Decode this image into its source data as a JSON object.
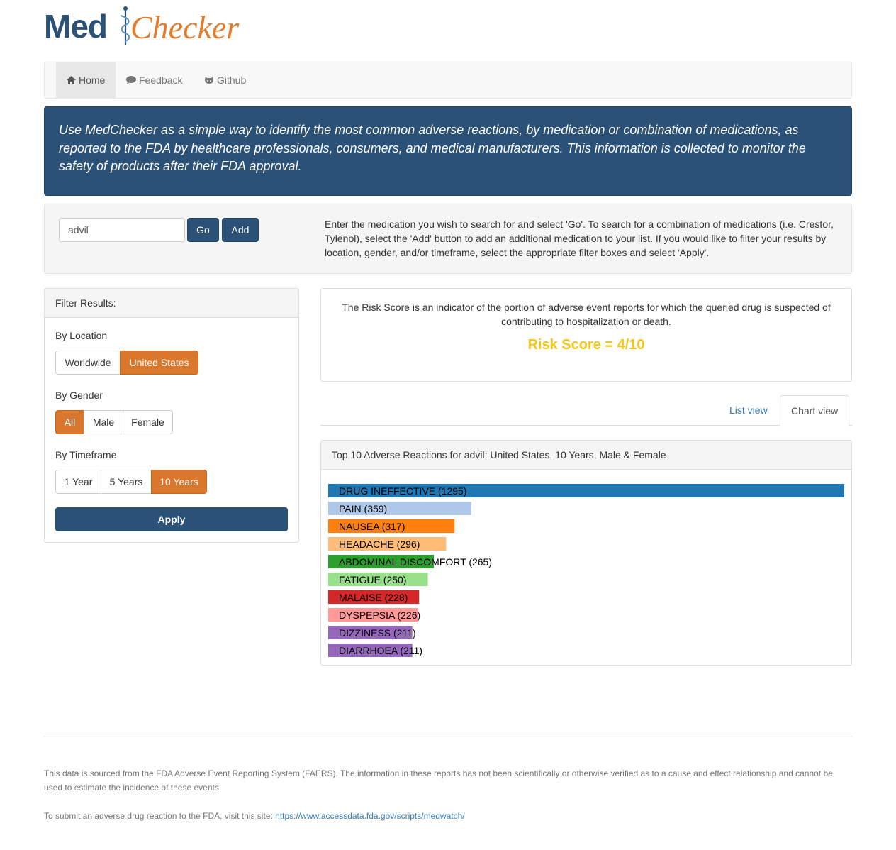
{
  "logo": {
    "part1": "Med",
    "part2": "Checker"
  },
  "nav": {
    "home": "Home",
    "feedback": "Feedback",
    "github": "Github"
  },
  "intro": "Use MedChecker as a simple way to identify the most common adverse reactions, by medication or combination of medications, as reported to the FDA by healthcare professionals, consumers, and medical manufacturers. This information is collected to monitor the safety of products after their FDA approval.",
  "search": {
    "value": "advil",
    "go_label": "Go",
    "add_label": "Add",
    "help": "Enter the medication you wish to search for and select 'Go'. To search for a combination of medications (i.e. Crestor, Tylenol), select the 'Add' button to add an additional medication to your list. If you would like to filter your results by location, gender, and/or timeframe, select the appropriate filter boxes and select 'Apply'."
  },
  "filter": {
    "heading": "Filter Results:",
    "location_label": "By Location",
    "location_options": [
      "Worldwide",
      "United States"
    ],
    "location_selected": "United States",
    "gender_label": "By Gender",
    "gender_options": [
      "All",
      "Male",
      "Female"
    ],
    "gender_selected": "All",
    "timeframe_label": "By Timeframe",
    "timeframe_options": [
      "1 Year",
      "5 Years",
      "10 Years"
    ],
    "timeframe_selected": "10 Years",
    "apply_label": "Apply"
  },
  "risk": {
    "description": "The Risk Score is an indicator of the portion of adverse event reports for which the queried drug is suspected of contributing to hospitalization or death.",
    "score_text": "Risk Score = 4/10",
    "score_color": "#f5c518"
  },
  "tabs": {
    "list": "List view",
    "chart": "Chart view",
    "active": "Chart view"
  },
  "chart_heading": "Top 10 Adverse Reactions for advil: United States, 10 Years, Male & Female",
  "chart_data": {
    "type": "bar",
    "orientation": "horizontal",
    "categories": [
      "DRUG INEFFECTIVE",
      "PAIN",
      "NAUSEA",
      "HEADACHE",
      "ABDOMINAL DISCOMFORT",
      "FATIGUE",
      "MALAISE",
      "DYSPEPSIA",
      "DIZZINESS",
      "DIARRHOEA"
    ],
    "values": [
      1295,
      359,
      317,
      296,
      265,
      250,
      228,
      226,
      211,
      211
    ],
    "labels": [
      "DRUG INEFFECTIVE (1295)",
      "PAIN (359)",
      "NAUSEA (317)",
      "HEADACHE (296)",
      "ABDOMINAL DISCOMFORT (265)",
      "FATIGUE (250)",
      "MALAISE (228)",
      "DYSPEPSIA (226)",
      "DIZZINESS (211)",
      "DIARRHOEA (211)"
    ],
    "colors": [
      "#1f77b4",
      "#aec7e8",
      "#ff7f0e",
      "#ffbb78",
      "#2ca02c",
      "#98df8a",
      "#d62728",
      "#ff9896",
      "#9467bd",
      "#9467bd"
    ],
    "xlim": [
      0,
      1295
    ],
    "grid": false
  },
  "footer": {
    "disclaimer": "This data is sourced from the FDA Adverse Event Reporting System (FAERS). The information in these reports has not been scientifically or otherwise verified as to a cause and effect relationship and cannot be used to estimate the incidence of these events.",
    "submit_text": "To submit an adverse drug reaction to the FDA, visit this site: ",
    "submit_link": "https://www.accessdata.fda.gov/scripts/medwatch/"
  },
  "icons": {
    "home": "home-icon",
    "feedback": "comment-icon",
    "github": "github-icon",
    "logo": "caduceus-icon"
  }
}
